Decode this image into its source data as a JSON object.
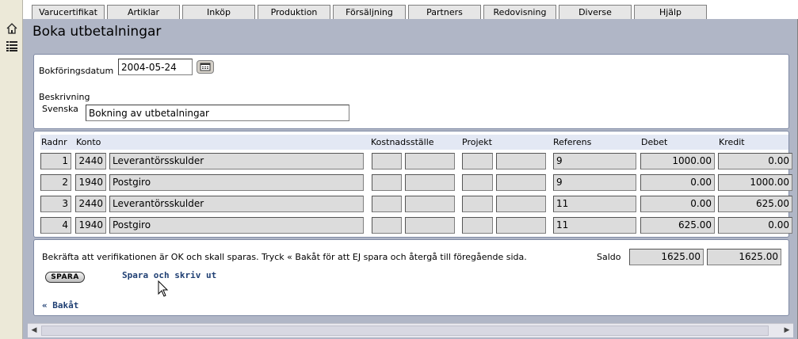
{
  "nav": {
    "tabs": [
      "Varucertifikat",
      "Artiklar",
      "Inköp",
      "Produktion",
      "Försäljning",
      "Partners",
      "Redovisning",
      "Diverse",
      "Hjälp"
    ]
  },
  "sidebar": {
    "icons": [
      "home-icon",
      "list-icon"
    ]
  },
  "page": {
    "title": "Boka utbetalningar"
  },
  "form": {
    "date_label": "Bokföringsdatum",
    "date_value": "2004-05-24",
    "description_label": "Beskrivning",
    "language_label": "Svenska",
    "description_value": "Bokning av utbetalningar"
  },
  "grid": {
    "headers": {
      "radnr": "Radnr",
      "konto": "Konto",
      "kostnadsstalle": "Kostnadsställe",
      "projekt": "Projekt",
      "referens": "Referens",
      "debet": "Debet",
      "kredit": "Kredit"
    },
    "rows": [
      {
        "radnr": "1",
        "konto": "2440",
        "name": "Leverantörsskulder",
        "ks1": "",
        "ks2": "",
        "pr1": "",
        "pr2": "",
        "referens": "9",
        "debet": "1000.00",
        "kredit": "0.00"
      },
      {
        "radnr": "2",
        "konto": "1940",
        "name": "Postgiro",
        "ks1": "",
        "ks2": "",
        "pr1": "",
        "pr2": "",
        "referens": "9",
        "debet": "0.00",
        "kredit": "1000.00"
      },
      {
        "radnr": "3",
        "konto": "2440",
        "name": "Leverantörsskulder",
        "ks1": "",
        "ks2": "",
        "pr1": "",
        "pr2": "",
        "referens": "11",
        "debet": "0.00",
        "kredit": "625.00"
      },
      {
        "radnr": "4",
        "konto": "1940",
        "name": "Postgiro",
        "ks1": "",
        "ks2": "",
        "pr1": "",
        "pr2": "",
        "referens": "11",
        "debet": "625.00",
        "kredit": "0.00"
      }
    ]
  },
  "footer": {
    "confirm_text": "Bekräfta att verifikationen är OK och skall sparas. Tryck « Bakåt för att EJ spara och återgå till föregående sida.",
    "saldo_label": "Saldo",
    "saldo_debet": "1625.00",
    "saldo_kredit": "1625.00",
    "save_button": "SPARA",
    "save_print_link": "Spara och skriv ut",
    "back_link": "« Bakåt"
  }
}
